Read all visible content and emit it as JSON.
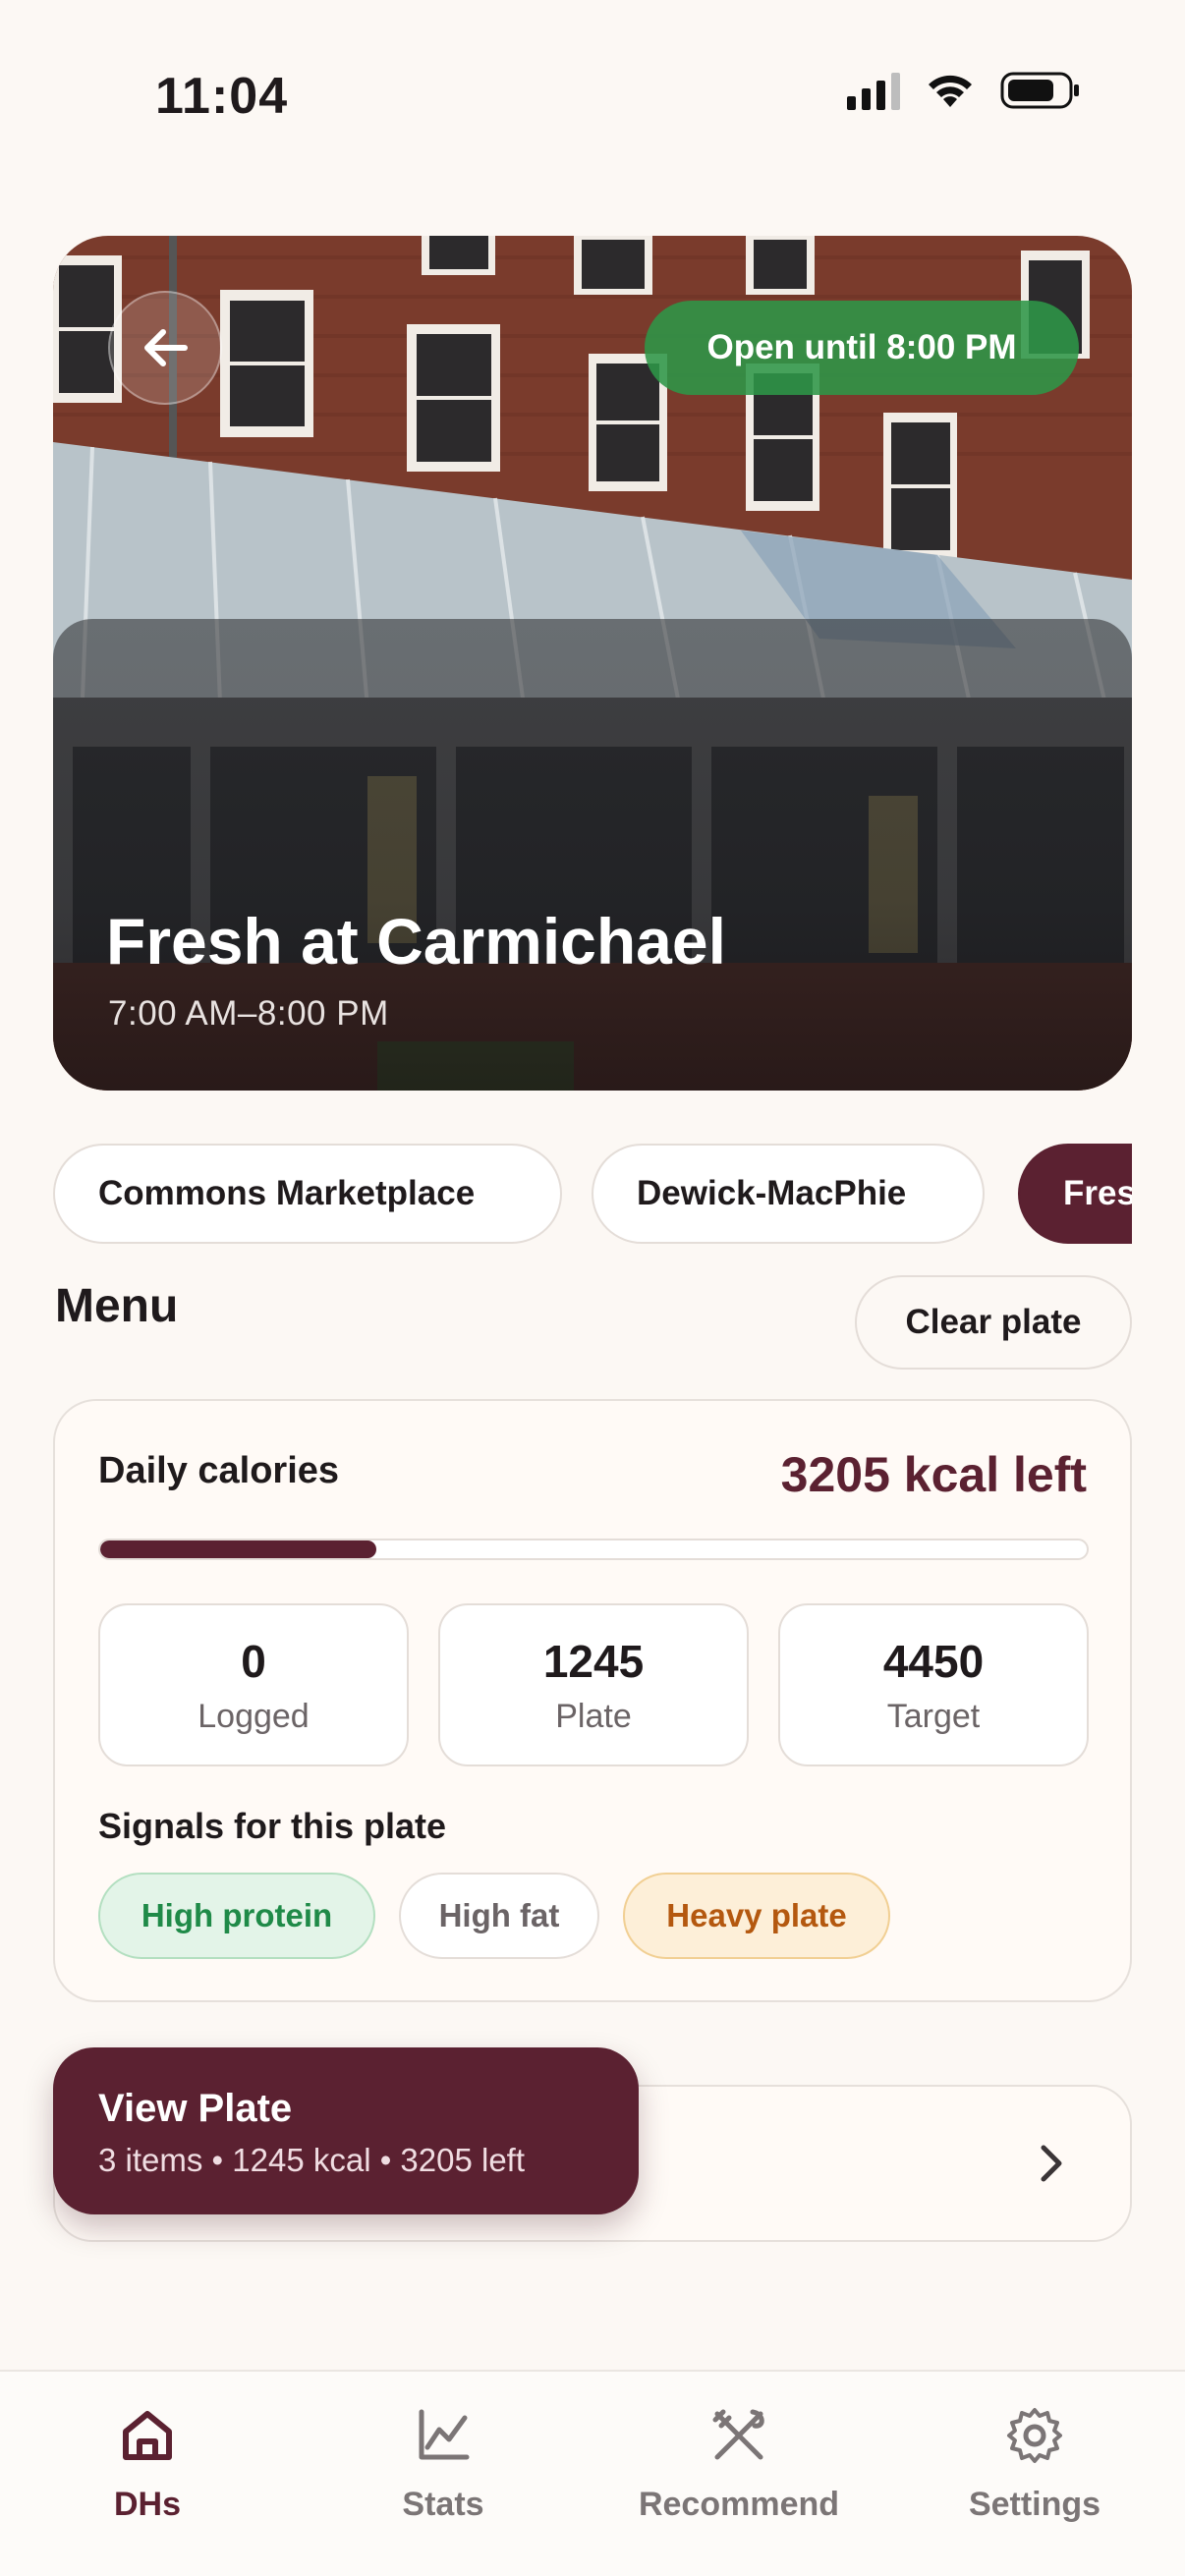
{
  "status_bar": {
    "time": "11:04"
  },
  "hero": {
    "title": "Fresh at Carmichael",
    "hours": "7:00 AM–8:00 PM",
    "open_status": "Open until 8:00 PM"
  },
  "halls": [
    {
      "label": "Commons Marketplace",
      "active": false
    },
    {
      "label": "Dewick-MacPhie",
      "active": false
    },
    {
      "label": "Fresh at Carmichael",
      "active": true
    }
  ],
  "menu": {
    "title": "Menu",
    "clear_label": "Clear plate"
  },
  "calories": {
    "label": "Daily calories",
    "left_text": "3205 kcal left",
    "progress_fraction": 0.28,
    "stats": [
      {
        "value": "0",
        "label": "Logged"
      },
      {
        "value": "1245",
        "label": "Plate"
      },
      {
        "value": "4450",
        "label": "Target"
      }
    ],
    "signals_title": "Signals for this plate",
    "signals": [
      {
        "label": "High protein",
        "tone": "green"
      },
      {
        "label": "High fat",
        "tone": "neutral"
      },
      {
        "label": "Heavy plate",
        "tone": "amber"
      }
    ]
  },
  "view_plate": {
    "title": "View Plate",
    "summary": "3 items • 1245 kcal • 3205 left"
  },
  "tabs": [
    {
      "label": "DHs",
      "icon": "home-icon",
      "active": true
    },
    {
      "label": "Stats",
      "icon": "chart-icon",
      "active": false
    },
    {
      "label": "Recommend",
      "icon": "utensils-crossed-icon",
      "active": false
    },
    {
      "label": "Settings",
      "icon": "gear-icon",
      "active": false
    }
  ],
  "colors": {
    "accent": "#5b2131",
    "open_green": "#2e9648",
    "background": "#fcf8f4"
  }
}
